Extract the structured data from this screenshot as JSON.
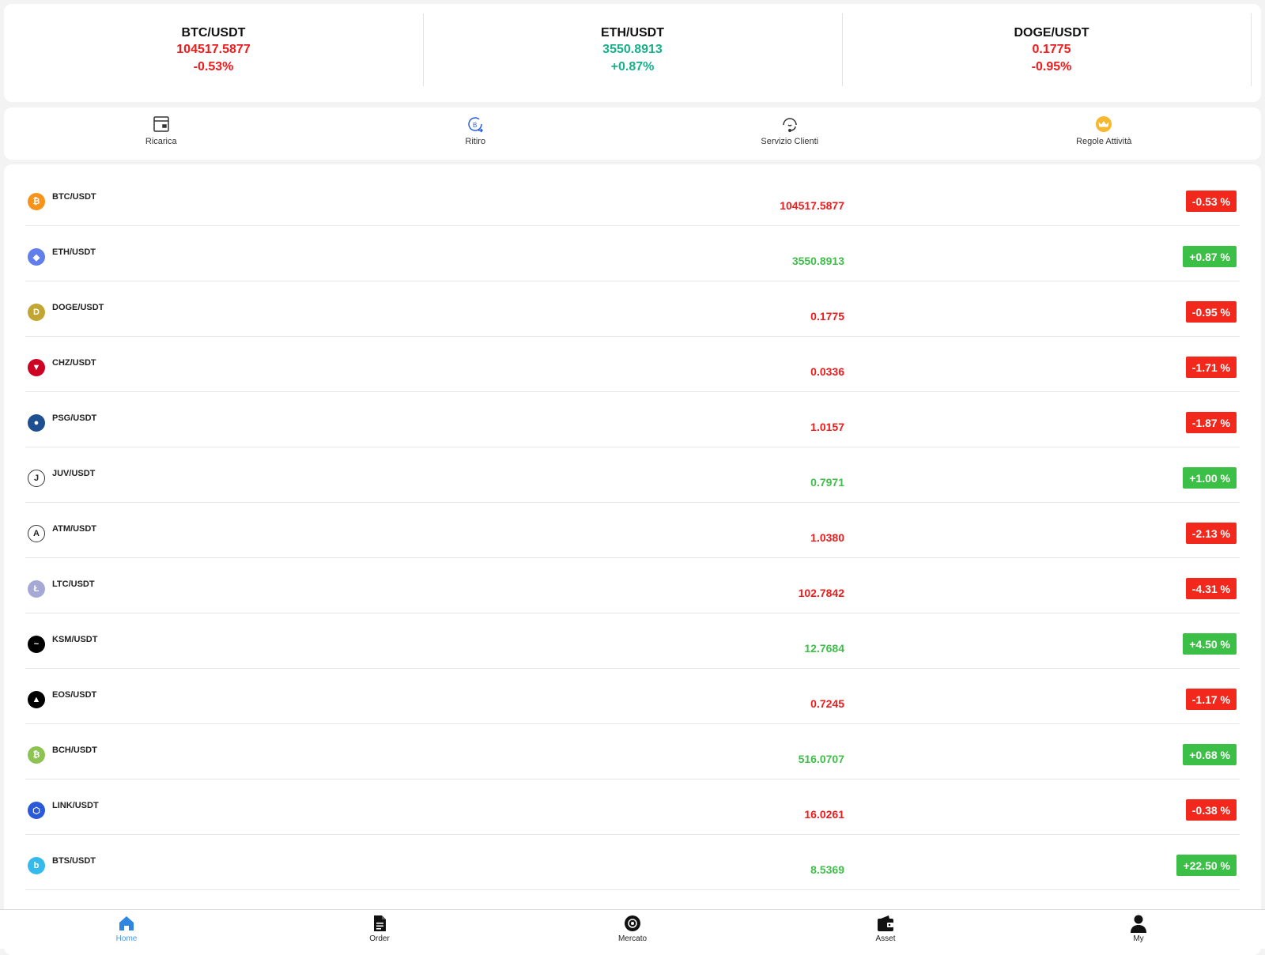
{
  "tickers": [
    {
      "symbol": "BTC/USDT",
      "price": "104517.5877",
      "change": "-0.53%",
      "trend": "down"
    },
    {
      "symbol": "ETH/USDT",
      "price": "3550.8913",
      "change": "+0.87%",
      "trend": "up"
    },
    {
      "symbol": "DOGE/USDT",
      "price": "0.1775",
      "change": "-0.95%",
      "trend": "down"
    }
  ],
  "quick_actions": [
    {
      "label": "Ricarica",
      "icon": "wallet-card-icon"
    },
    {
      "label": "Ritiro",
      "icon": "withdraw-coin-icon"
    },
    {
      "label": "Servizio Clienti",
      "icon": "headset-support-icon"
    },
    {
      "label": "Regole Attività",
      "icon": "crown-icon"
    }
  ],
  "market": [
    {
      "pair": "BTC/USDT",
      "price": "104517.5877",
      "change": "-0.53 %",
      "trend": "down",
      "icon": "bitcoin-icon",
      "color": "#f7931a",
      "glyph": "₿"
    },
    {
      "pair": "ETH/USDT",
      "price": "3550.8913",
      "change": "+0.87 %",
      "trend": "up",
      "icon": "ethereum-icon",
      "color": "#627eea",
      "glyph": "◆"
    },
    {
      "pair": "DOGE/USDT",
      "price": "0.1775",
      "change": "-0.95 %",
      "trend": "down",
      "icon": "dogecoin-icon",
      "color": "#c2a633",
      "glyph": "D"
    },
    {
      "pair": "CHZ/USDT",
      "price": "0.0336",
      "change": "-1.71 %",
      "trend": "down",
      "icon": "chiliz-icon",
      "color": "#cd0124",
      "glyph": "▼"
    },
    {
      "pair": "PSG/USDT",
      "price": "1.0157",
      "change": "-1.87 %",
      "trend": "down",
      "icon": "psg-icon",
      "color": "#1d4f91",
      "glyph": "●"
    },
    {
      "pair": "JUV/USDT",
      "price": "0.7971",
      "change": "+1.00 %",
      "trend": "up",
      "icon": "juventus-icon",
      "color": "#ffffff",
      "glyph": "J"
    },
    {
      "pair": "ATM/USDT",
      "price": "1.0380",
      "change": "-2.13 %",
      "trend": "down",
      "icon": "atletico-icon",
      "color": "#ffffff",
      "glyph": "A"
    },
    {
      "pair": "LTC/USDT",
      "price": "102.7842",
      "change": "-4.31 %",
      "trend": "down",
      "icon": "litecoin-icon",
      "color": "#a6a9d6",
      "glyph": "Ł"
    },
    {
      "pair": "KSM/USDT",
      "price": "12.7684",
      "change": "+4.50 %",
      "trend": "up",
      "icon": "kusama-icon",
      "color": "#000000",
      "glyph": "~"
    },
    {
      "pair": "EOS/USDT",
      "price": "0.7245",
      "change": "-1.17 %",
      "trend": "down",
      "icon": "eos-icon",
      "color": "#000000",
      "glyph": "▲"
    },
    {
      "pair": "BCH/USDT",
      "price": "516.0707",
      "change": "+0.68 %",
      "trend": "up",
      "icon": "bitcoin-cash-icon",
      "color": "#8dc351",
      "glyph": "₿"
    },
    {
      "pair": "LINK/USDT",
      "price": "16.0261",
      "change": "-0.38 %",
      "trend": "down",
      "icon": "chainlink-icon",
      "color": "#2a5ada",
      "glyph": "⬡"
    },
    {
      "pair": "BTS/USDT",
      "price": "8.5369",
      "change": "+22.50 %",
      "trend": "up",
      "icon": "bitshares-icon",
      "color": "#35baeb",
      "glyph": "b"
    }
  ],
  "bottom_nav": [
    {
      "label": "Home",
      "icon": "home-icon",
      "active": true
    },
    {
      "label": "Order",
      "icon": "order-document-icon",
      "active": false
    },
    {
      "label": "Mercato",
      "icon": "market-globe-icon",
      "active": false
    },
    {
      "label": "Asset",
      "icon": "wallet-icon",
      "active": false
    },
    {
      "label": "My",
      "icon": "user-profile-icon",
      "active": false
    }
  ],
  "colors": {
    "down": "#ee1c1c",
    "up_ticker": "#16b08b",
    "up_list": "#3fbf4a",
    "badge_down": "#f2281d",
    "badge_up": "#3cbf47",
    "nav_active": "#4a98e8"
  }
}
